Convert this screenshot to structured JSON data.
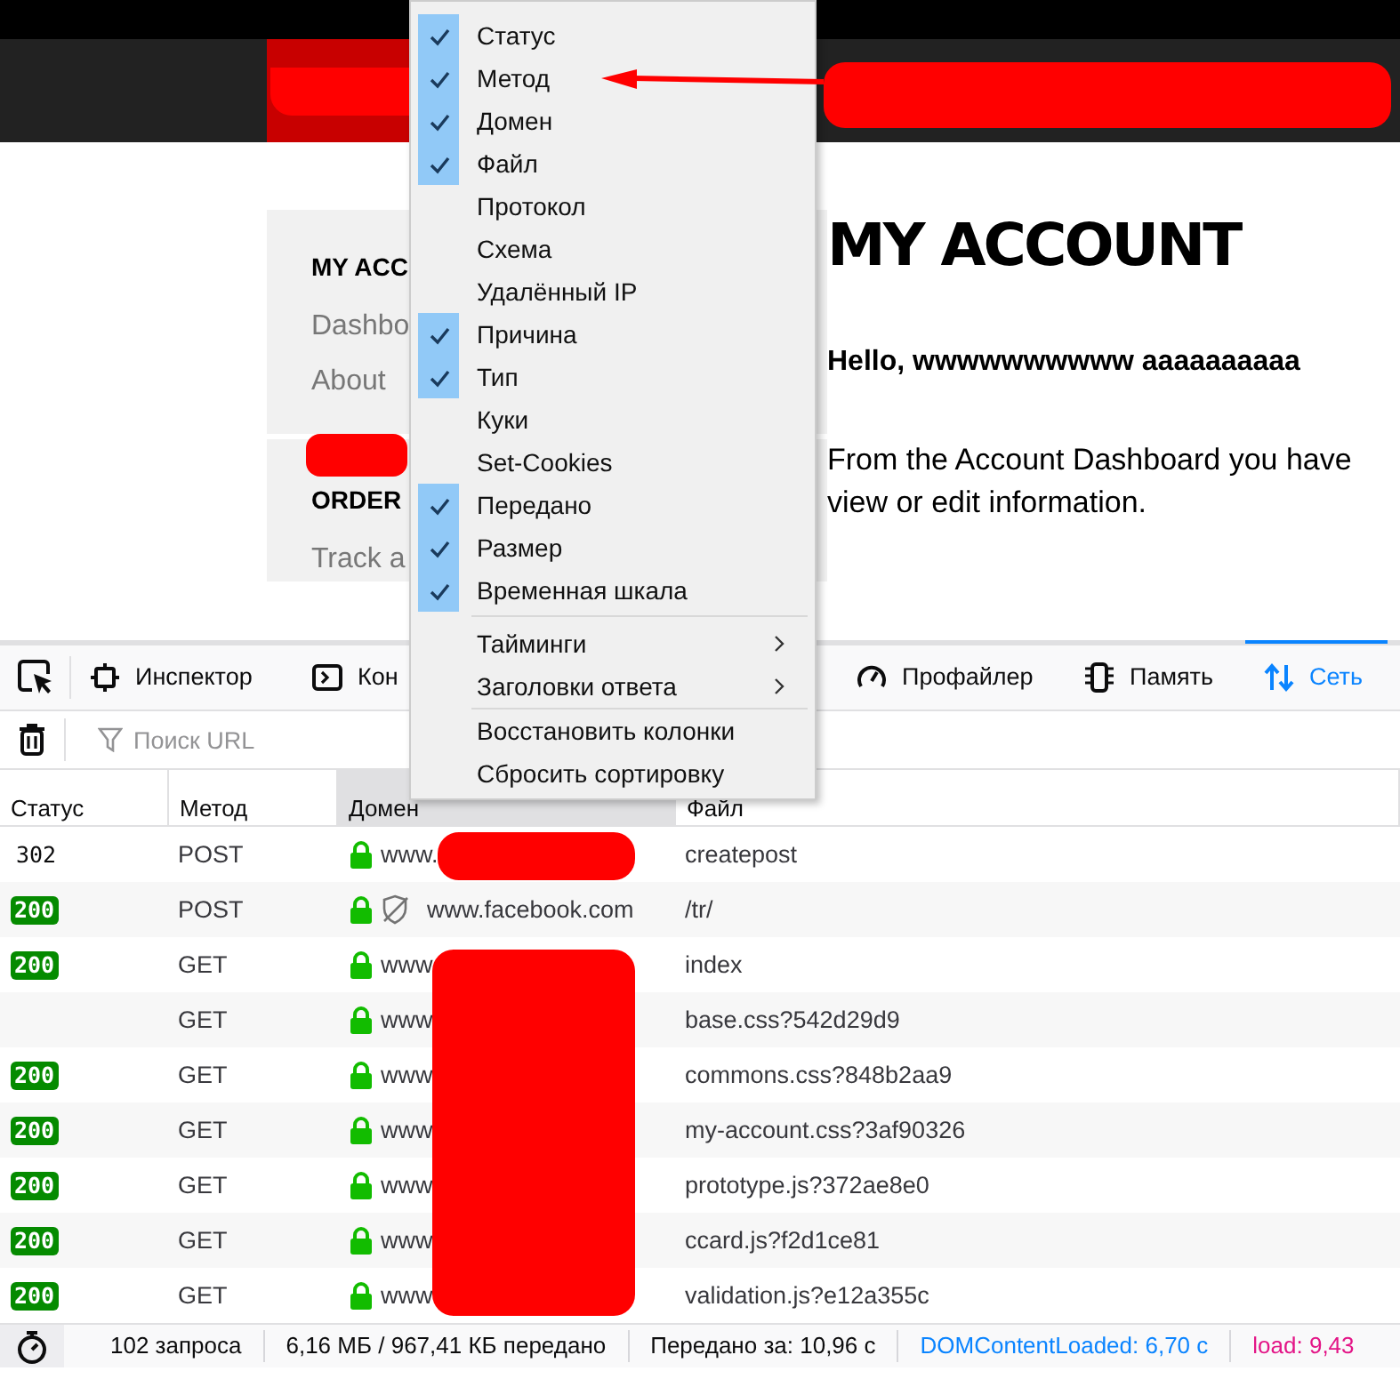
{
  "site": {
    "sidebar": [
      {
        "title": "MY ACC",
        "links": [
          "Dashbo",
          "About"
        ]
      },
      {
        "title": "ORDER",
        "links": [
          "Track a"
        ]
      }
    ],
    "main": {
      "heading": "MY ACCOUNT",
      "greeting": "Hello, wwwwwwwwww aaaaaaaaaa",
      "intro": [
        "From the Account Dashboard you have",
        "view or edit information."
      ]
    }
  },
  "devtools": {
    "tabs": [
      {
        "label": "Инспектор",
        "selected": false
      },
      {
        "label": "Кон",
        "selected": false
      },
      {
        "label": "Профайлер",
        "selected": false
      },
      {
        "label": "Память",
        "selected": false
      },
      {
        "label": "Сеть",
        "selected": true
      }
    ],
    "filter": {
      "placeholder": "Поиск URL"
    },
    "table": {
      "columns": [
        {
          "label": "Статус",
          "selected": false
        },
        {
          "label": "Метод",
          "selected": false
        },
        {
          "label": "Домен",
          "selected": true
        },
        {
          "label": "Файл",
          "selected": false
        }
      ],
      "rows": [
        {
          "status": {
            "kind": "plain",
            "code": "302"
          },
          "method": "POST",
          "domain": "www.",
          "tracker": false,
          "file": "createpost"
        },
        {
          "status": {
            "kind": "badge",
            "code": "200"
          },
          "method": "POST",
          "domain": "www.facebook.com",
          "tracker": true,
          "file": "/tr/"
        },
        {
          "status": {
            "kind": "badge",
            "code": "200"
          },
          "method": "GET",
          "domain": "www",
          "tracker": false,
          "file": "index"
        },
        {
          "method": "GET",
          "domain": "www",
          "tracker": false,
          "file": "base.css?542d29d9"
        },
        {
          "status": {
            "kind": "badge",
            "code": "200"
          },
          "method": "GET",
          "domain": "www",
          "tracker": false,
          "file": "commons.css?848b2aa9"
        },
        {
          "status": {
            "kind": "badge",
            "code": "200"
          },
          "method": "GET",
          "domain": "www",
          "tracker": false,
          "file": "my-account.css?3af90326"
        },
        {
          "status": {
            "kind": "badge",
            "code": "200"
          },
          "method": "GET",
          "domain": "www",
          "tracker": false,
          "file": "prototype.js?372ae8e0"
        },
        {
          "status": {
            "kind": "badge",
            "code": "200"
          },
          "method": "GET",
          "domain": "www",
          "tracker": false,
          "file": "ccard.js?f2d1ce81"
        },
        {
          "status": {
            "kind": "badge",
            "code": "200"
          },
          "method": "GET",
          "domain": "www",
          "tracker": false,
          "file": "validation.js?e12a355c"
        }
      ]
    },
    "status_bar": [
      {
        "kind": "plain",
        "text": "102 запроса"
      },
      {
        "kind": "plain",
        "text": "6,16 МБ / 967,41 КБ передано"
      },
      {
        "kind": "plain",
        "text": "Передано за: 10,96 с"
      },
      {
        "kind": "dcl",
        "text": "DOMContentLoaded: 6,70 с"
      },
      {
        "kind": "load",
        "text": "load: 9,43"
      }
    ]
  },
  "context_menu": {
    "sections": [
      {
        "items": [
          {
            "kind": "check",
            "label": "Статус",
            "checked": true
          },
          {
            "kind": "check",
            "label": "Метод",
            "checked": true
          },
          {
            "kind": "check",
            "label": "Домен",
            "checked": true
          },
          {
            "kind": "check",
            "label": "Файл",
            "checked": true
          },
          {
            "kind": "check",
            "label": "Протокол",
            "checked": false
          },
          {
            "kind": "check",
            "label": "Схема",
            "checked": false
          },
          {
            "kind": "check",
            "label": "Удалённый IP",
            "checked": false
          },
          {
            "kind": "check",
            "label": "Причина",
            "checked": true
          },
          {
            "kind": "check",
            "label": "Тип",
            "checked": true
          },
          {
            "kind": "check",
            "label": "Куки",
            "checked": false
          },
          {
            "kind": "check",
            "label": "Set-Cookies",
            "checked": false
          },
          {
            "kind": "check",
            "label": "Передано",
            "checked": true
          },
          {
            "kind": "check",
            "label": "Размер",
            "checked": true
          },
          {
            "kind": "check",
            "label": "Временная шкала",
            "checked": true
          }
        ]
      },
      {
        "items": [
          {
            "kind": "submenu",
            "label": "Тайминги"
          },
          {
            "kind": "submenu",
            "label": "Заголовки ответа"
          }
        ]
      },
      {
        "items": [
          {
            "kind": "action",
            "label": "Восстановить колонки"
          },
          {
            "kind": "action",
            "label": "Сбросить сортировку"
          }
        ]
      }
    ]
  }
}
